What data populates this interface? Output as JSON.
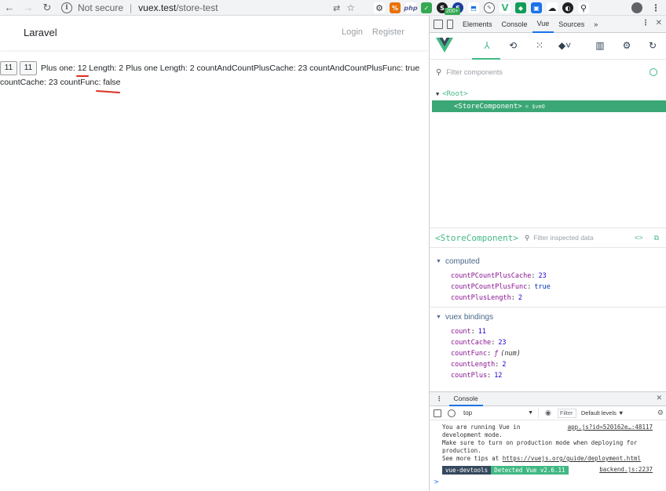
{
  "browser": {
    "security_label": "Not secure",
    "url_host": "vuex.test",
    "url_path": "/store-test",
    "badge": "200+",
    "ext_php": "php"
  },
  "page": {
    "brand": "Laravel",
    "login": "Login",
    "register": "Register",
    "btn_a": "11",
    "btn_b": "11",
    "line1": "Plus one: 12 Length: 2 Plus one Length: 2 countAndCountPlusCache: 23 countAndCountPlusFunc: true",
    "line2": "countCache: 23 countFunc: false"
  },
  "devtools": {
    "tabs": [
      "Elements",
      "Console",
      "Vue",
      "Sources"
    ],
    "more": "»",
    "filter_components": "Filter components",
    "root_node": "<Root>",
    "component_node": "<StoreComponent>",
    "vm_tag": "= $vm0",
    "inspect_title": "<StoreComponent>",
    "filter_inspected": "Filter inspected data",
    "computed_title": "computed",
    "computed": [
      {
        "key": "countPCountPlusCache",
        "value": "23"
      },
      {
        "key": "countPCountPlusFunc",
        "value": "true"
      },
      {
        "key": "countPlusLength",
        "value": "2"
      }
    ],
    "vuex_title": "vuex bindings",
    "vuex": [
      {
        "key": "count",
        "value": "11"
      },
      {
        "key": "countCache",
        "value": "23"
      },
      {
        "key": "countFunc",
        "fn_symbol": "ƒ",
        "value": "(num)"
      },
      {
        "key": "countLength",
        "value": "2"
      },
      {
        "key": "countPlus",
        "value": "12"
      }
    ]
  },
  "console": {
    "tab": "Console",
    "context": "top",
    "filter": "Filter",
    "levels": "Default levels ▼",
    "msg1": "You are running Vue in",
    "msg1_src": "app.js?id=520162e…:48117",
    "msg2": "development mode.",
    "msg3": "Make sure to turn on production mode when deploying for",
    "msg4": "production.",
    "msg5_prefix": "See more tips at ",
    "msg5_link": "https://vuejs.org/guide/deployment.html",
    "pill_a": "vue-devtools",
    "pill_b": "Detected Vue v2.6.11",
    "pill_src": "backend.js:2237",
    "prompt": ">"
  },
  "colors": {
    "vue_green": "#42b983",
    "selected_row": "#3ba776",
    "underline_red": "#d93025"
  }
}
